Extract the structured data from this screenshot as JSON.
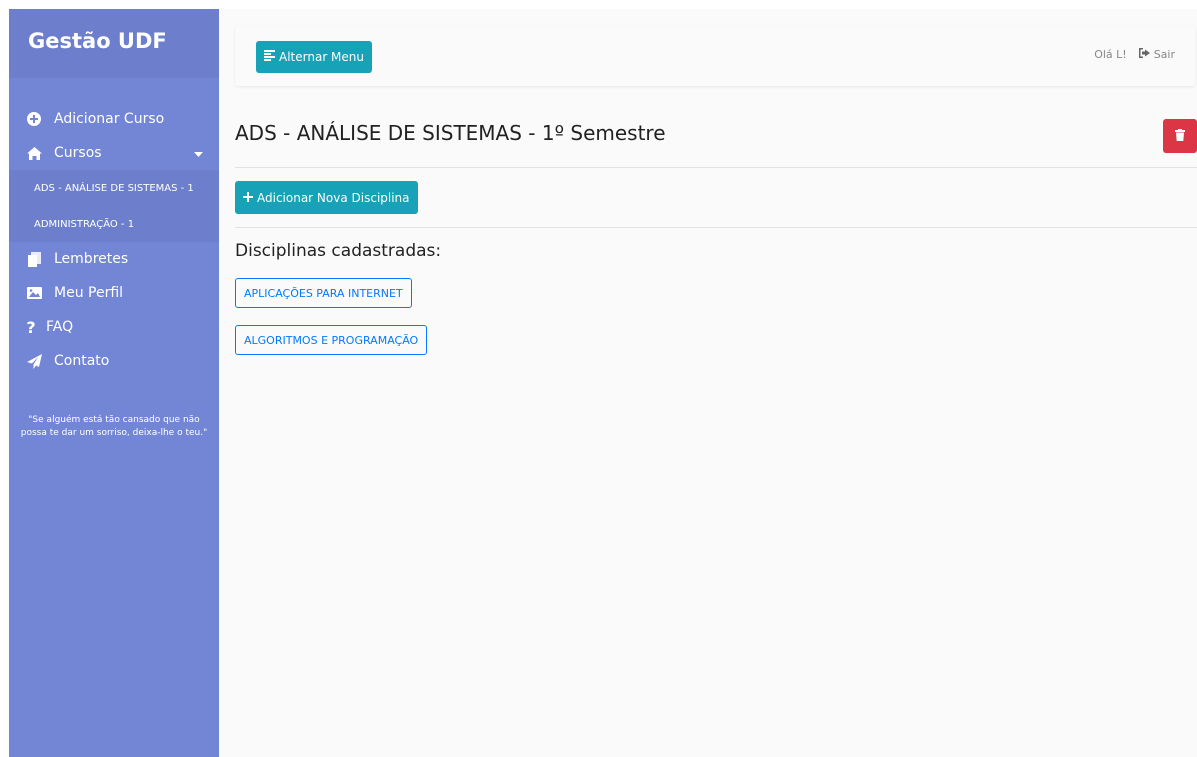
{
  "sidebar": {
    "brand": "Gestão UDF",
    "items": [
      {
        "label": "Adicionar Curso",
        "icon": "plus-circle-icon"
      },
      {
        "label": "Cursos",
        "icon": "home-icon"
      },
      {
        "label": "Lembretes",
        "icon": "copy-icon"
      },
      {
        "label": "Meu Perfil",
        "icon": "image-icon"
      },
      {
        "label": "FAQ",
        "icon": "question-icon"
      },
      {
        "label": "Contato",
        "icon": "paper-plane-icon"
      }
    ],
    "courses": [
      "ADS - ANÁLISE DE SISTEMAS - 1",
      "ADMINISTRAÇÃO - 1"
    ],
    "quote": "\"Se alguém está tão cansado que não\npossa te dar um sorriso, deixa-lhe o teu.\""
  },
  "topbar": {
    "toggle_label": "Alternar Menu",
    "greeting": "Olá L!",
    "logout_label": "Sair"
  },
  "main": {
    "title": "ADS - ANÁLISE DE SISTEMAS - 1º Semestre",
    "add_label": "Adicionar Nova Disciplina",
    "subtitle": "Disciplinas cadastradas:",
    "disciplines": [
      "APLICAÇÕES PARA INTERNET",
      "ALGORITMOS E PROGRAMAÇÃO"
    ]
  },
  "colors": {
    "sidebar": "#7386d5",
    "sidebar_dark": "#6d7fcc",
    "teal": "#17a2b8",
    "danger": "#dc3545",
    "primary": "#007bff"
  }
}
